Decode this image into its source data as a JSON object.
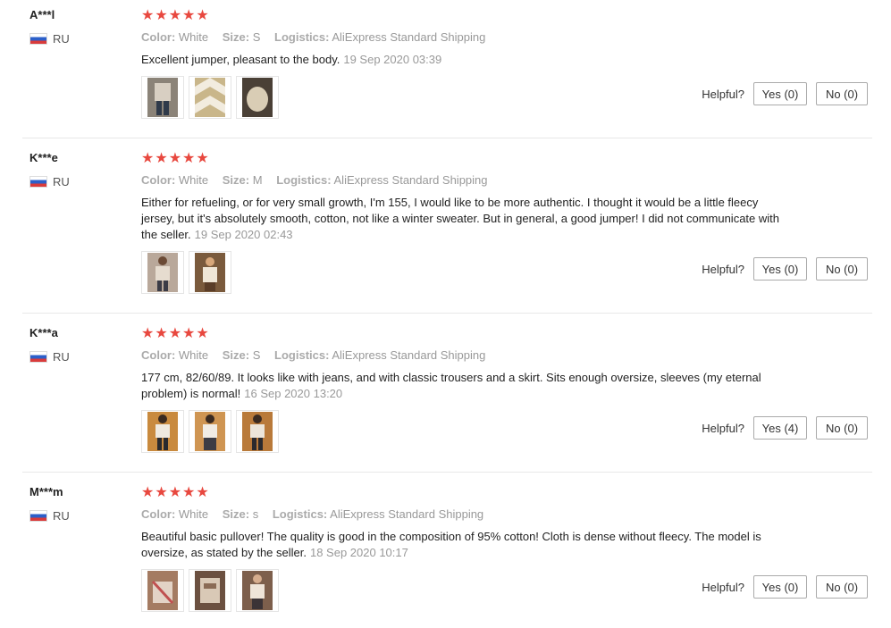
{
  "labels": {
    "color": "Color:",
    "size": "Size:",
    "logistics": "Logistics:",
    "helpful": "Helpful?"
  },
  "reviews": [
    {
      "user": "A***l",
      "country": "RU",
      "stars": "★★★★★",
      "rating": 5,
      "color": "White",
      "size": "S",
      "logistics": "AliExpress Standard Shipping",
      "text": "Excellent jumper, pleasant to the body.",
      "date": "19 Sep 2020 03:39",
      "yes": "Yes (0)",
      "no": "No (0)"
    },
    {
      "user": "K***e",
      "country": "RU",
      "stars": "★★★★★",
      "rating": 5,
      "color": "White",
      "size": "M",
      "logistics": "AliExpress Standard Shipping",
      "text": "Either for refueling, or for very small growth, I'm 155, I would like to be more authentic. I thought it would be a little fleecy jersey, but it's absolutely smooth, cotton, not like a winter sweater. But in general, a good jumper! I did not communicate with the seller.",
      "date": "19 Sep 2020 02:43",
      "yes": "Yes (0)",
      "no": "No (0)"
    },
    {
      "user": "K***a",
      "country": "RU",
      "stars": "★★★★★",
      "rating": 5,
      "color": "White",
      "size": "S",
      "logistics": "AliExpress Standard Shipping",
      "text": "177 cm, 82/60/89. It looks like with jeans, and with classic trousers and a skirt. Sits enough oversize, sleeves (my eternal problem) is normal!",
      "date": "16 Sep 2020 13:20",
      "yes": "Yes (4)",
      "no": "No (0)"
    },
    {
      "user": "M***m",
      "country": "RU",
      "stars": "★★★★★",
      "rating": 5,
      "color": "White",
      "size": "s",
      "logistics": "AliExpress Standard Shipping",
      "text": "Beautiful basic pullover! The quality is good in the composition of 95% cotton! Cloth is dense without fleecy. The model is oversize, as stated by the seller.",
      "date": "18 Sep 2020 10:17",
      "yes": "Yes (0)",
      "no": "No (0)"
    }
  ],
  "colors": {
    "star": "#e8483f",
    "divider": "#e8e8e8",
    "meta_text": "#999999"
  }
}
